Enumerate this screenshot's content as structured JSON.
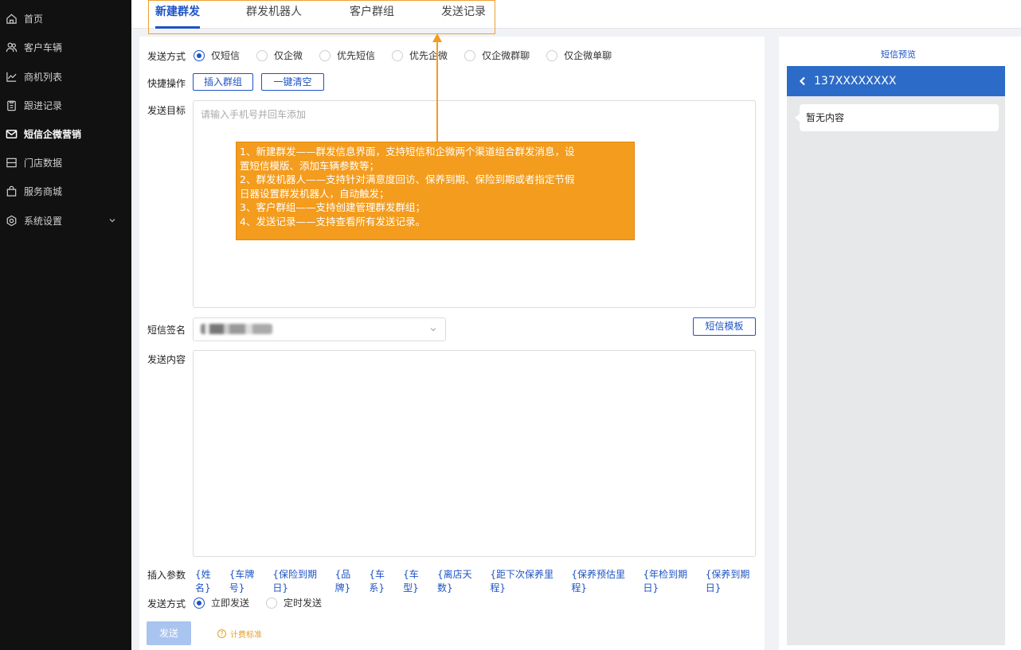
{
  "sidebar": {
    "items": [
      {
        "label": "首页",
        "icon": "home-icon"
      },
      {
        "label": "客户车辆",
        "icon": "users-icon"
      },
      {
        "label": "商机列表",
        "icon": "trend-chart-icon"
      },
      {
        "label": "跟进记录",
        "icon": "clipboard-icon"
      },
      {
        "label": "短信企微营销",
        "icon": "mail-icon",
        "active": true
      },
      {
        "label": "门店数据",
        "icon": "table-icon"
      },
      {
        "label": "服务商城",
        "icon": "shopping-bag-icon"
      },
      {
        "label": "系统设置",
        "icon": "settings-icon",
        "has_submenu": true
      }
    ]
  },
  "tabs": [
    {
      "label": "新建群发",
      "active": true
    },
    {
      "label": "群发机器人"
    },
    {
      "label": "客户群组"
    },
    {
      "label": "发送记录"
    }
  ],
  "form": {
    "send_mode": {
      "label": "发送方式",
      "options": [
        "仅短信",
        "仅企微",
        "优先短信",
        "优先企微",
        "仅企微群聊",
        "仅企微单聊"
      ],
      "selected": "仅短信"
    },
    "quick_actions": {
      "label": "快捷操作",
      "insert_group": "插入群组",
      "clear_all": "一键清空"
    },
    "target": {
      "label": "发送目标",
      "placeholder": "请输入手机号并回车添加"
    },
    "signature": {
      "label": "短信签名",
      "template_button": "短信模板"
    },
    "content": {
      "label": "发送内容"
    },
    "params": {
      "label": "插入参数",
      "items": [
        "{姓名}",
        "{车牌号}",
        "{保险到期日}",
        "{品牌}",
        "{车系}",
        "{车型}",
        "{离店天数}",
        "{距下次保养里程}",
        "{保养预估里程}",
        "{年检到期日}",
        "{保养到期日}"
      ]
    },
    "timing": {
      "label": "发送方式",
      "options": [
        "立即发送",
        "定时发送"
      ],
      "selected": "立即发送"
    },
    "send_button": "发送",
    "fee_link": "计费标准",
    "fee_icon": "question-circle-icon"
  },
  "annotation": {
    "lines": [
      "1、新建群发——群发信息界面，支持短信和企微两个渠道组合群发消息，设",
      "置短信模版、添加车辆参数等；",
      "2、群发机器人——支持针对满意度回访、保养到期、保险到期或者指定节假",
      "日器设置群发机器人，自动触发；",
      "3、客户群组——支持创建管理群发群组；",
      "4、发送记录——支持查看所有发送记录。"
    ],
    "color": "#f39c1e"
  },
  "preview": {
    "title": "短信预览",
    "phone": "137XXXXXXXX",
    "empty_text": "暂无内容"
  },
  "colors": {
    "accent": "#1d53c4",
    "sidebar_bg": "#111111",
    "preview_header": "#2d6bc8"
  }
}
